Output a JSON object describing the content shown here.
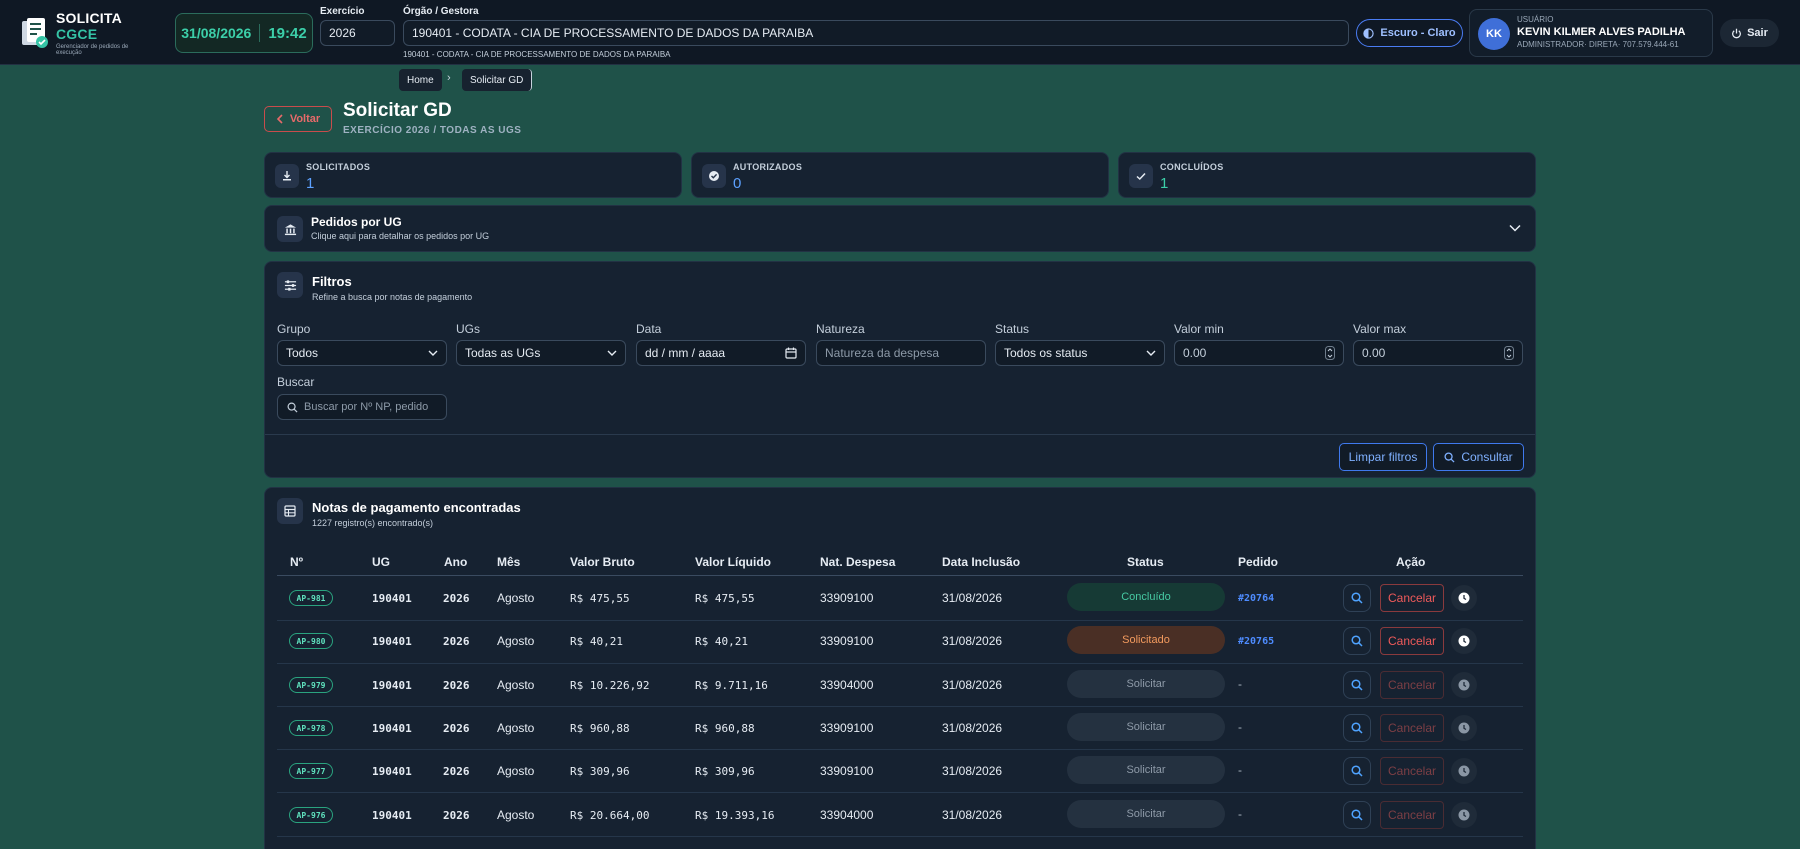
{
  "app": {
    "logo_title_a": "SOLICITA",
    "logo_title_b": "CGCE",
    "logo_subtitle": "Gerenciador de pedidos de execução",
    "date": "31/08/2026",
    "time": "19:42"
  },
  "header": {
    "exercicio_label": "Exercício",
    "exercicio_value": "2026",
    "orgao_label": "Órgão / Gestora",
    "orgao_value": "190401 - CODATA - CIA DE PROCESSAMENTO DE DADOS DA PARAIBA",
    "orgao_sub": "190401 - CODATA - CIA DE PROCESSAMENTO DE DADOS DA PARAIBA",
    "theme_label": "Escuro - Claro",
    "user_label": "USUÁRIO",
    "user_initials": "KK",
    "user_name": "KEVIN KILMER ALVES PADILHA",
    "user_role": "ADMINISTRADOR· DIRETA· 707.579.444-61",
    "logout_label": "Sair"
  },
  "breadcrumb": {
    "home": "Home",
    "sep": "›",
    "current": "Solicitar GD"
  },
  "page": {
    "back_label": "Voltar",
    "title": "Solicitar GD",
    "subtitle": "EXERCÍCIO 2026 / TODAS AS UGS"
  },
  "stats": [
    {
      "label": "SOLICITADOS",
      "value": "1"
    },
    {
      "label": "AUTORIZADOS",
      "value": "0"
    },
    {
      "label": "CONCLUÍDOS",
      "value": "1"
    }
  ],
  "pedidos_ug": {
    "title": "Pedidos por UG",
    "subtitle": "Clique aqui para detalhar os pedidos por UG"
  },
  "filters": {
    "title": "Filtros",
    "subtitle": "Refine a busca por notas de pagamento",
    "grupo": {
      "label": "Grupo",
      "value": "Todos"
    },
    "ugs": {
      "label": "UGs",
      "value": "Todas as UGs"
    },
    "data": {
      "label": "Data",
      "value": "dd / mm / aaaa"
    },
    "natureza": {
      "label": "Natureza",
      "placeholder": "Natureza da despesa"
    },
    "status": {
      "label": "Status",
      "value": "Todos os status"
    },
    "valor_min": {
      "label": "Valor min",
      "value": "0.00"
    },
    "valor_max": {
      "label": "Valor max",
      "value": "0.00"
    },
    "buscar": {
      "label": "Buscar",
      "placeholder": "Buscar por Nº NP, pedido"
    },
    "clear_label": "Limpar filtros",
    "search_label": "Consultar"
  },
  "results": {
    "title": "Notas de pagamento encontradas",
    "subtitle": "1227 registro(s) encontrado(s)",
    "columns": [
      "Nº",
      "UG",
      "Ano",
      "Mês",
      "Valor Bruto",
      "Valor Líquido",
      "Nat. Despesa",
      "Data Inclusão",
      "Status",
      "Pedido",
      "Ação"
    ],
    "cancel_label": "Cancelar",
    "rows": [
      {
        "np": "AP-981",
        "ug": "190401",
        "ano": "2026",
        "mes": "Agosto",
        "bruto": "R$ 475,55",
        "liquido": "R$ 475,55",
        "nat": "33909100",
        "data": "31/08/2026",
        "status": "Concluído",
        "pedido": "#20764"
      },
      {
        "np": "AP-980",
        "ug": "190401",
        "ano": "2026",
        "mes": "Agosto",
        "bruto": "R$ 40,21",
        "liquido": "R$ 40,21",
        "nat": "33909100",
        "data": "31/08/2026",
        "status": "Solicitado",
        "pedido": "#20765"
      },
      {
        "np": "AP-979",
        "ug": "190401",
        "ano": "2026",
        "mes": "Agosto",
        "bruto": "R$ 10.226,92",
        "liquido": "R$ 9.711,16",
        "nat": "33904000",
        "data": "31/08/2026",
        "status": "Solicitar",
        "pedido": "-"
      },
      {
        "np": "AP-978",
        "ug": "190401",
        "ano": "2026",
        "mes": "Agosto",
        "bruto": "R$ 960,88",
        "liquido": "R$ 960,88",
        "nat": "33909100",
        "data": "31/08/2026",
        "status": "Solicitar",
        "pedido": "-"
      },
      {
        "np": "AP-977",
        "ug": "190401",
        "ano": "2026",
        "mes": "Agosto",
        "bruto": "R$ 309,96",
        "liquido": "R$ 309,96",
        "nat": "33909100",
        "data": "31/08/2026",
        "status": "Solicitar",
        "pedido": "-"
      },
      {
        "np": "AP-976",
        "ug": "190401",
        "ano": "2026",
        "mes": "Agosto",
        "bruto": "R$ 20.664,00",
        "liquido": "R$ 19.393,16",
        "nat": "33904000",
        "data": "31/08/2026",
        "status": "Solicitar",
        "pedido": "-"
      }
    ]
  }
}
